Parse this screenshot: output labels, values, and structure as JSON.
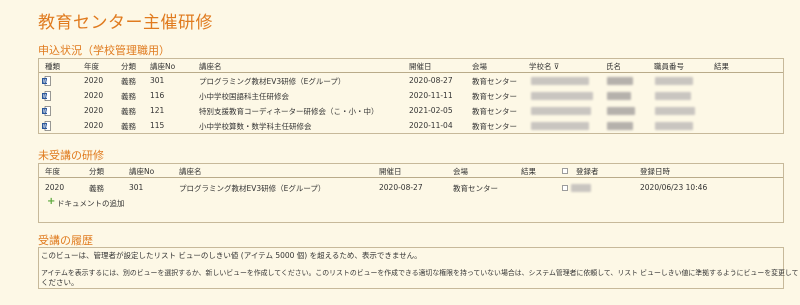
{
  "page_title": "教育センター主催研修",
  "section1": {
    "title": "申込状況（学校管理職用）",
    "headers": [
      "種類",
      "年度",
      "分類",
      "講座No",
      "講座名",
      "開催日",
      "会場",
      "学校名",
      "氏名",
      "職員番号",
      "結果"
    ],
    "school_header_filter": "学校名 ⊽",
    "rows": [
      {
        "year": "2020",
        "category": "義務",
        "no": "301",
        "name": "プログラミング教材EV3研修（Eグループ）",
        "date": "2020-08-27",
        "venue": "教育センター"
      },
      {
        "year": "2020",
        "category": "義務",
        "no": "116",
        "name": "小中学校国語科主任研修会",
        "date": "2020-11-11",
        "venue": "教育センター"
      },
      {
        "year": "2020",
        "category": "義務",
        "no": "121",
        "name": "特別支援教育コーディネーター研修会（こ・小・中）",
        "date": "2021-02-05",
        "venue": "教育センター"
      },
      {
        "year": "2020",
        "category": "義務",
        "no": "115",
        "name": "小中学校算数・数学科主任研修会",
        "date": "2020-11-04",
        "venue": "教育センター"
      }
    ]
  },
  "section2": {
    "title": "未受講の研修",
    "headers": [
      "年度",
      "分類",
      "講座No",
      "講座名",
      "開催日",
      "会場",
      "結果",
      "登録者",
      "登録日時"
    ],
    "rows": [
      {
        "year": "2020",
        "category": "義務",
        "no": "301",
        "name": "プログラミング教材EV3研修（Eグループ）",
        "date": "2020-08-27",
        "venue": "教育センター",
        "registered_at": "2020/06/23 10:46"
      }
    ],
    "add_link": "ドキュメントの追加"
  },
  "section3": {
    "title": "受講の履歴",
    "line1": "このビューは、管理者が設定したリスト ビューのしきい値 (アイテム 5000 個) を超えるため、表示できません。",
    "line2": "アイテムを表示するには、別のビューを選択するか、新しいビューを作成してください。このリストのビューを作成できる適切な権限を持っていない場合は、システム管理者に依頼して、リスト ビューしきい値に準拠するようにビューを変更して",
    "line3": "ください。"
  }
}
